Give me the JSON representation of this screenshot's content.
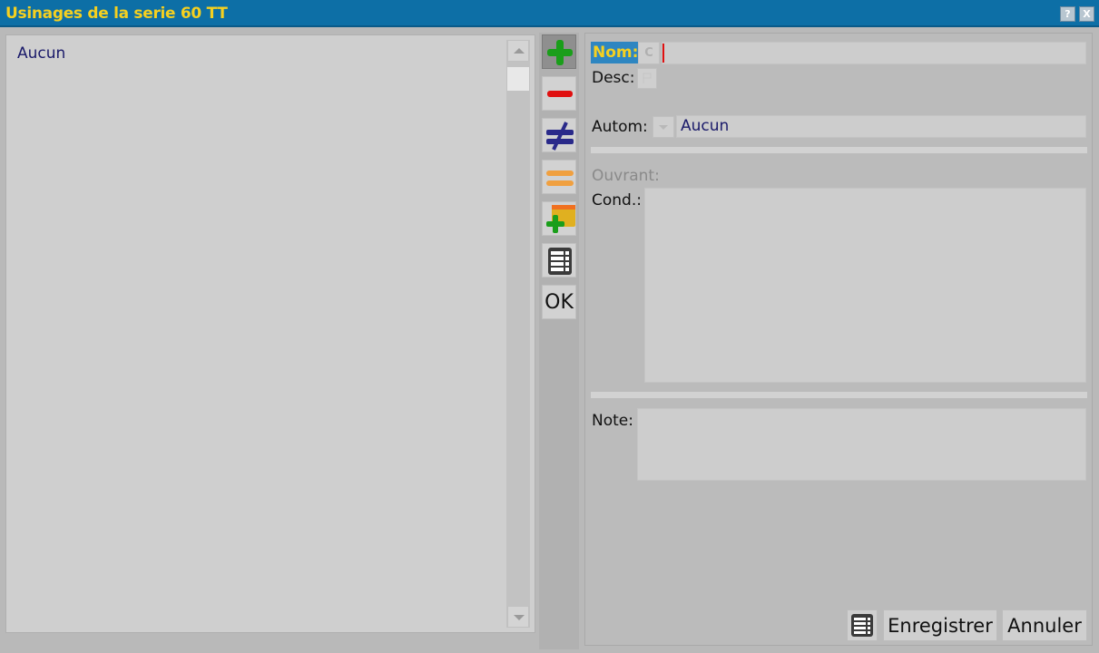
{
  "window": {
    "title": "Usinages de la serie 60 TT",
    "help_label": "?",
    "close_label": "X"
  },
  "list": {
    "items": [
      {
        "label": "Aucun"
      }
    ]
  },
  "toolbar": {
    "buttons": [
      {
        "name": "add-icon"
      },
      {
        "name": "remove-icon"
      },
      {
        "name": "not-equal-icon"
      },
      {
        "name": "equal-icon"
      },
      {
        "name": "add-folder-icon"
      },
      {
        "name": "table-icon"
      }
    ],
    "ok_label": "OK"
  },
  "form": {
    "nom_label": "Nom:",
    "nom_value": "",
    "c_button_label": "C",
    "desc_label": "Desc:",
    "autom_label": "Autom:",
    "autom_value": "Aucun",
    "ouvrant_label": "Ouvrant:",
    "cond_label": "Cond.:",
    "cond_value": "",
    "note_label": "Note:",
    "note_value": ""
  },
  "actions": {
    "save_label": "Enregistrer",
    "cancel_label": "Annuler"
  },
  "colors": {
    "titlebar": "#0d6fa6",
    "title_text": "#f5d020",
    "add_green": "#1a9e1a",
    "remove_red": "#e01010",
    "not_equal_blue": "#2a2a8a",
    "equal_orange": "#f0a040"
  }
}
